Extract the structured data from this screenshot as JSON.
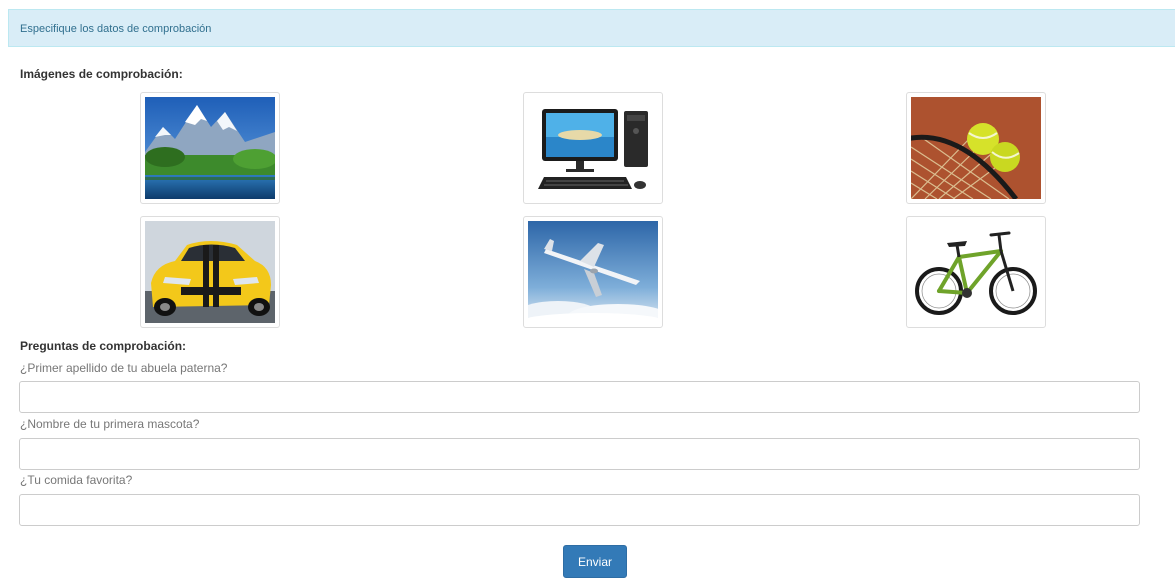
{
  "header": {
    "title": "Especifique los datos de comprobación"
  },
  "images_section": {
    "label": "Imágenes de comprobación:",
    "images": [
      {
        "subject": "mountain-lake"
      },
      {
        "subject": "desktop-computer"
      },
      {
        "subject": "tennis-balls-racket"
      },
      {
        "subject": "yellow-sports-car"
      },
      {
        "subject": "airplane"
      },
      {
        "subject": "bicycle"
      }
    ]
  },
  "questions_section": {
    "label": "Preguntas de comprobación:",
    "questions": [
      {
        "label": "¿Primer apellido de tu abuela paterna?",
        "value": ""
      },
      {
        "label": "¿Nombre de tu primera mascota?",
        "value": ""
      },
      {
        "label": "¿Tu comida favorita?",
        "value": ""
      }
    ]
  },
  "submit": {
    "label": "Enviar"
  },
  "colors": {
    "header_bg": "#d9edf7",
    "header_text": "#31708f",
    "button_bg": "#337ab7"
  }
}
